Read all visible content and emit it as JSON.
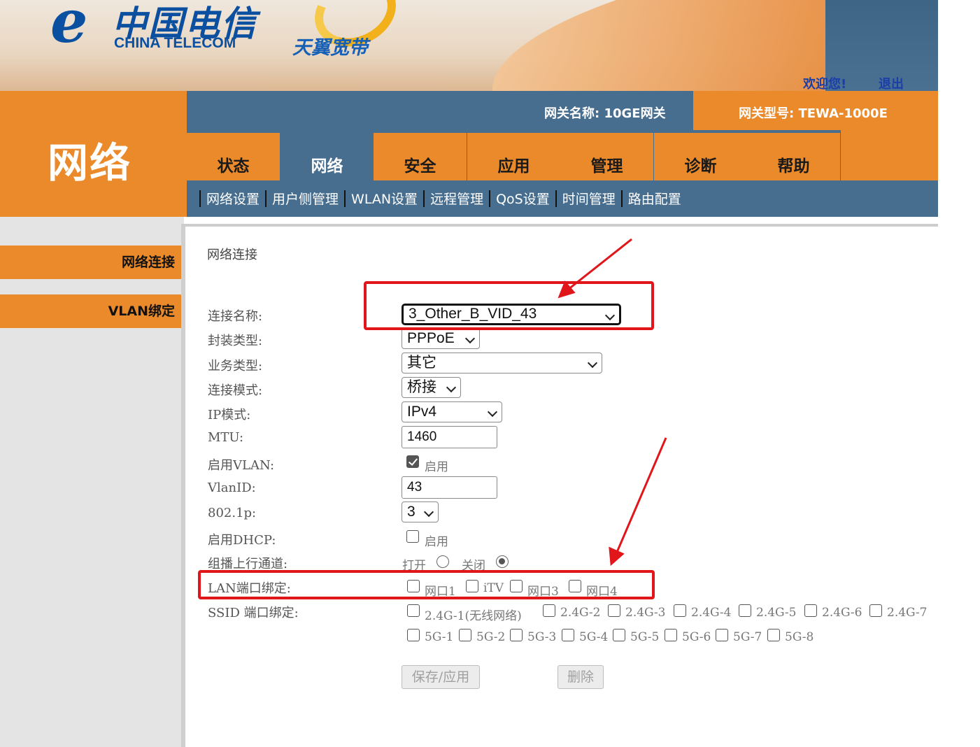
{
  "header": {
    "brand_cn": "中国电信",
    "brand_en": "CHINA TELECOM",
    "product": "天翼宽带",
    "welcome": "欢迎您!",
    "logout": "退出",
    "gateway_name": "网关名称:  10GE网关",
    "gateway_model": "网关型号: TEWA-1000E"
  },
  "section_title": "网络",
  "tabs": [
    {
      "label": "状态",
      "active": false
    },
    {
      "label": "网络",
      "active": true
    },
    {
      "label": "安全",
      "active": false
    },
    {
      "label": "应用",
      "active": false
    },
    {
      "label": "管理",
      "active": false
    },
    {
      "label": "诊断",
      "active": false
    },
    {
      "label": "帮助",
      "active": false
    }
  ],
  "subnav": [
    "网络设置",
    "用户侧管理",
    "WLAN设置",
    "远程管理",
    "QoS设置",
    "时间管理",
    "路由配置"
  ],
  "sidebar": [
    "网络连接",
    "VLAN绑定"
  ],
  "content": {
    "title": "网络连接",
    "labels": {
      "conn_name": "连接名称:",
      "encap": "封装类型:",
      "service": "业务类型:",
      "conn_mode": "连接模式:",
      "ip_mode": "IP模式:",
      "mtu": "MTU:",
      "vlan_enable": "启用VLAN:",
      "vlan_id": "VlanID:",
      "p8021": "802.1p:",
      "dhcp_enable": "启用DHCP:",
      "multicast": "组播上行通道:",
      "lan_bind": "LAN端口绑定:",
      "ssid_bind": "SSID 端口绑定:"
    },
    "values": {
      "conn_name": "3_Other_B_VID_43",
      "encap": "PPPoE",
      "service": "其它",
      "conn_mode": "桥接",
      "ip_mode": "IPv4",
      "mtu": "1460",
      "vlan_id": "43",
      "p8021": "3"
    },
    "enable_text": "启用",
    "vlan_enabled": true,
    "dhcp_enabled": false,
    "multicast_options": [
      "打开",
      "关闭"
    ],
    "multicast_selected": "关闭",
    "lan_ports": [
      "网口1",
      "iTV",
      "网口3",
      "网口4"
    ],
    "ssid_24g": [
      "2.4G-1(无线网络)",
      "2.4G-2",
      "2.4G-3",
      "2.4G-4",
      "2.4G-5",
      "2.4G-6",
      "2.4G-7"
    ],
    "ssid_5g": [
      "5G-1",
      "5G-2",
      "5G-3",
      "5G-4",
      "5G-5",
      "5G-6",
      "5G-7",
      "5G-8"
    ],
    "save_button": "保存/应用",
    "delete_button": "删除"
  },
  "annotation_color": "#e0161b"
}
